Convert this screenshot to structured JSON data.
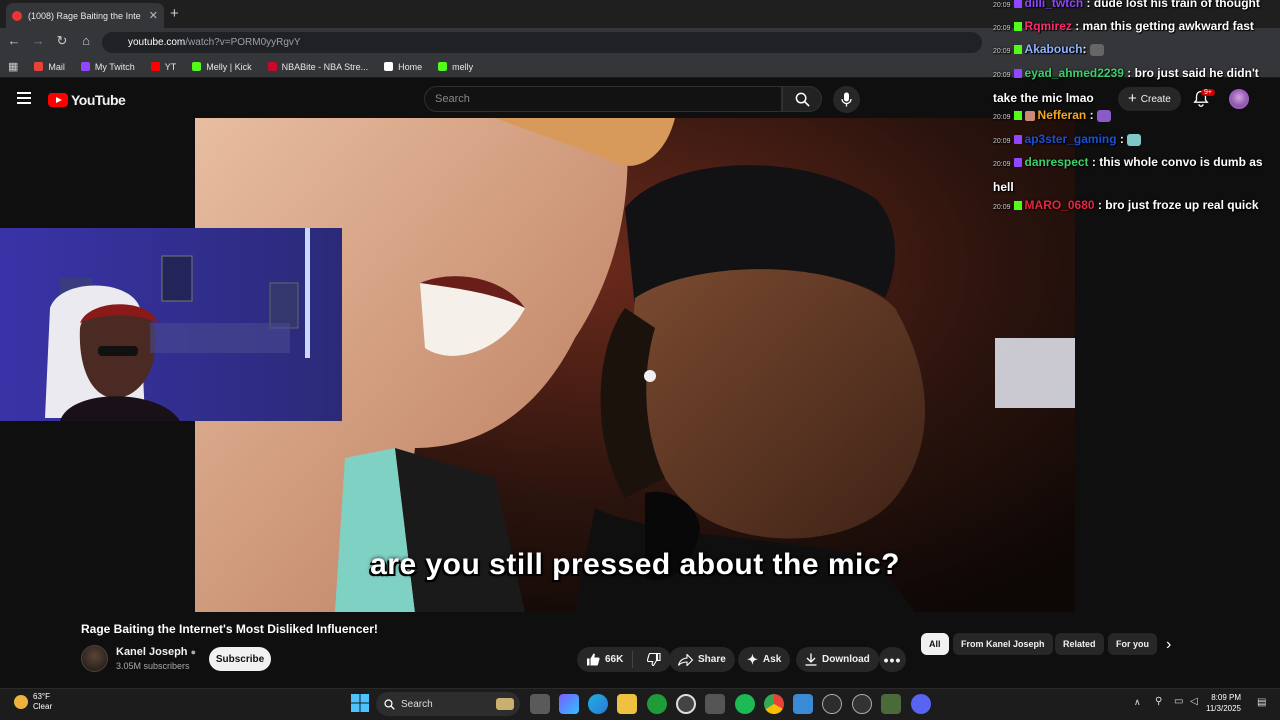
{
  "browser": {
    "tab_title": "(1008) Rage Baiting the Inte",
    "url_site": "youtube.com",
    "url_path": "/watch?v=PORM0yyRgvY",
    "bookmarks": [
      {
        "label": "Mail",
        "icon": "gmail-icon",
        "color": "#ea4335"
      },
      {
        "label": "My Twitch",
        "icon": "twitch-icon",
        "color": "#9146ff"
      },
      {
        "label": "YT",
        "icon": "youtube-icon",
        "color": "#ff0000"
      },
      {
        "label": "Melly | Kick",
        "icon": "kick-icon",
        "color": "#53fc18"
      },
      {
        "label": "NBABite - NBA Stre...",
        "icon": "nba-icon",
        "color": "#c9082a"
      },
      {
        "label": "Home",
        "icon": "x-icon",
        "color": "#ffffff"
      },
      {
        "label": "melly",
        "icon": "kick-icon",
        "color": "#53fc18"
      }
    ]
  },
  "youtube": {
    "logo_text": "YouTube",
    "search_placeholder": "Search",
    "create_label": "Create",
    "notif_badge": "9+",
    "caption": "are you still pressed about the mic?",
    "video_title": "Rage Baiting the Internet's Most Disliked Influencer!",
    "channel_name": "Kanel Joseph",
    "channel_subs": "3.05M subscribers",
    "subscribe_label": "Subscribe",
    "likes": "66K",
    "share_label": "Share",
    "ask_label": "Ask",
    "download_label": "Download",
    "chips": [
      "All",
      "From Kanel Joseph",
      "Related",
      "For you"
    ]
  },
  "chat": [
    {
      "time": "20:09",
      "badge": "twitch",
      "user": "dilli_twtch",
      "color": "#9146ff",
      "text": ": dude lost his train of thought"
    },
    {
      "time": "20:09",
      "badge": "kick",
      "user": "Rqmirez",
      "color": "#ff2a6d",
      "text": ": man this getting awkward fast"
    },
    {
      "time": "20:09",
      "badge": "kick",
      "user": "Akabouch",
      "color": "#8fb3ff",
      "text": ":"
    },
    {
      "time": "20:09",
      "badge": "twitch",
      "user": "eyad_ahmed2239",
      "color": "#3ad16b",
      "text": ": bro just said he didn't take the mic lmao"
    },
    {
      "time": "20:09",
      "badge": "kick",
      "user": "Nefferan",
      "color": "#f5a623",
      "text": ":"
    },
    {
      "time": "20:09",
      "badge": "twitch",
      "user": "ap3ster_gaming",
      "color": "#1e4fd8",
      "text": ":"
    },
    {
      "time": "20:09",
      "badge": "twitch",
      "user": "danrespect",
      "color": "#3ad16b",
      "text": ": this whole convo is dumb as hell"
    },
    {
      "time": "20:09",
      "badge": "kick",
      "user": "MARO_0680",
      "color": "#e8263e",
      "text": ": bro just froze up real quick"
    }
  ],
  "taskbar": {
    "temp": "63°F",
    "condition": "Clear",
    "search_label": "Search",
    "time": "8:09 PM",
    "date": "11/3/2025"
  }
}
